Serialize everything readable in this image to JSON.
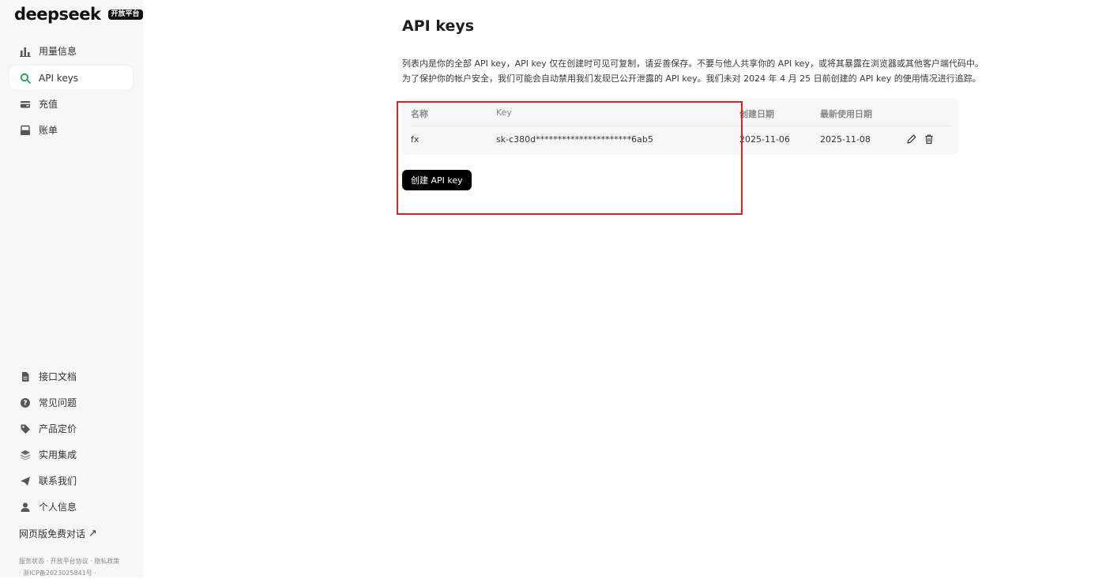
{
  "brand": {
    "name": "deepseek",
    "badge": "开放平台"
  },
  "sidebar": {
    "top_items": [
      {
        "label": "用量信息",
        "icon": "bar-chart-icon"
      },
      {
        "label": "API keys",
        "icon": "search-key-icon",
        "active": true
      },
      {
        "label": "充值",
        "icon": "wallet-icon"
      },
      {
        "label": "账单",
        "icon": "bill-icon"
      }
    ],
    "bottom_items": [
      {
        "label": "接口文档",
        "icon": "document-icon"
      },
      {
        "label": "常见问题",
        "icon": "help-circle-icon"
      },
      {
        "label": "产品定价",
        "icon": "tag-icon"
      },
      {
        "label": "实用集成",
        "icon": "layers-icon"
      },
      {
        "label": "联系我们",
        "icon": "send-icon"
      },
      {
        "label": "个人信息",
        "icon": "user-icon"
      }
    ],
    "web_chat": {
      "label": "网页版免费对话",
      "icon": "external-arrow-icon"
    },
    "footer": {
      "service_status": "服务状态",
      "platform_agreement": "开放平台协议",
      "privacy": "隐私政策",
      "icp": "浙ICP备2023025841号"
    }
  },
  "main": {
    "title": "API keys",
    "description": [
      "列表内是你的全部 API key，API key 仅在创建时可见可复制，请妥善保存。不要与他人共享你的 API key，或将其暴露在浏览器或其他客户端代码中。",
      "为了保护你的帐户安全，我们可能会自动禁用我们发现已公开泄露的 API key。我们未对 2024 年 4 月 25 日前创建的 API key 的使用情况进行追踪。"
    ],
    "table": {
      "headers": {
        "name": "名称",
        "key": "Key",
        "created": "创建日期",
        "last_used": "最新使用日期"
      },
      "rows": [
        {
          "name": "fx",
          "key": "sk-c380d**********************6ab5",
          "created": "2025-11-06",
          "last_used": "2025-11-08"
        }
      ]
    },
    "create_button": "创建 API key"
  },
  "colors": {
    "accent_green": "#16a34a",
    "highlight_red": "#e02020"
  }
}
